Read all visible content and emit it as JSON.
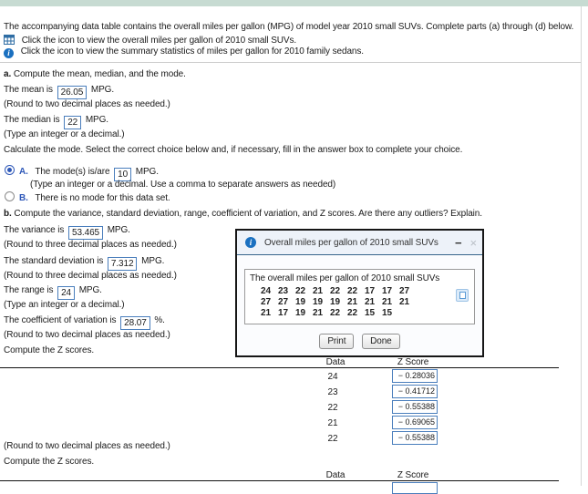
{
  "colors": {
    "top_bar": "#c7dbd2",
    "answer_box_border": "#4a7ebc",
    "choice_label_blue": "#2e58b8",
    "dialog_title_bg": "#edf2f9",
    "icon_blue": "#1a70c0"
  },
  "intro": {
    "text": "The accompanying data table contains the overall miles per gallon (MPG) of model year 2010 small SUVs. Complete parts (a) through (d) below.",
    "link_table": "Click the icon to view the overall miles per gallon of 2010 small SUVs.",
    "link_info": "Click the icon to view the summary statistics of miles per gallon for 2010 family sedans."
  },
  "part_a": {
    "label": "a.",
    "prompt": "Compute the mean, median, and the mode.",
    "mean": {
      "prefix": "The mean is",
      "value": "26.05",
      "suffix": "MPG.",
      "hint": "(Round to two decimal places as needed.)"
    },
    "median": {
      "prefix": "The median is",
      "value": "22",
      "suffix": "MPG.",
      "hint": "(Type an integer or a decimal.)"
    },
    "mode_prompt": "Calculate the mode. Select the correct choice below and, if necessary, fill in the answer box to complete your choice.",
    "choice_a": {
      "label": "A.",
      "text_before": "The mode(s) is/are",
      "value": "10",
      "text_after": "MPG.",
      "hint": "(Type an integer or a decimal. Use a comma to separate answers as needed)"
    },
    "choice_b": {
      "label": "B.",
      "text": "There is no mode for this data set."
    }
  },
  "part_b": {
    "label": "b.",
    "prompt": "Compute the variance, standard deviation, range, coefficient of variation, and Z scores. Are there any outliers? Explain.",
    "variance": {
      "prefix": "The variance is",
      "value": "53.465",
      "suffix": "MPG.",
      "hint": "(Round to three decimal places as needed.)"
    },
    "std_dev": {
      "prefix": "The standard deviation is",
      "value": "7.312",
      "suffix": "MPG.",
      "hint": "(Round to three decimal places as needed.)"
    },
    "range": {
      "prefix": "The range is",
      "value": "24",
      "suffix": "MPG.",
      "hint": "(Type an integer or a decimal.)"
    },
    "cv": {
      "prefix": "The coefficient of variation is",
      "value": "28.07",
      "suffix": "%.",
      "hint": "(Round to two decimal places as needed.)"
    },
    "z_prompt_1": "Compute the Z scores.",
    "z_round_hint": "(Round to two decimal places as needed.)",
    "z_prompt_2": "Compute the Z scores."
  },
  "z_table": {
    "col_data": "Data",
    "col_z": "Z Score",
    "rows": [
      {
        "data": "24",
        "z": "− 0.28036"
      },
      {
        "data": "23",
        "z": "− 0.41712"
      },
      {
        "data": "22",
        "z": "− 0.55388"
      },
      {
        "data": "21",
        "z": "− 0.69065"
      },
      {
        "data": "22",
        "z": "− 0.55388"
      }
    ]
  },
  "z_table_2": {
    "col_data": "Data",
    "col_z": "Z Score"
  },
  "dialog": {
    "title": "Overall miles per gallon of 2010 small SUVs",
    "minimize_glyph": "−",
    "close_glyph": "×",
    "inner_title": "The overall miles per gallon of 2010 small SUVs",
    "rows": [
      [
        "24",
        "23",
        "22",
        "21",
        "22",
        "22",
        "17",
        "17",
        "27"
      ],
      [
        "27",
        "27",
        "19",
        "19",
        "19",
        "21",
        "21",
        "21",
        "21"
      ],
      [
        "21",
        "17",
        "19",
        "21",
        "22",
        "22",
        "15",
        "15"
      ]
    ],
    "print_label": "Print",
    "done_label": "Done",
    "info_glyph": "i"
  }
}
